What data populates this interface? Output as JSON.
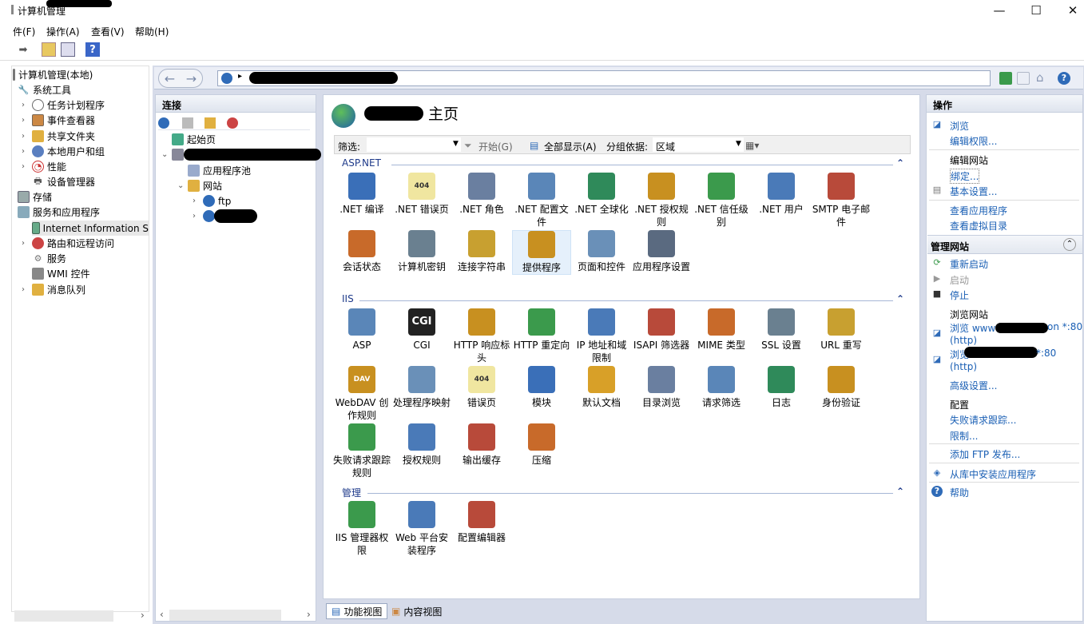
{
  "window": {
    "title": "计算机管理",
    "min": "—",
    "max": "☐",
    "close": "✕"
  },
  "menu": [
    "件(F)",
    "操作(A)",
    "查看(V)",
    "帮助(H)"
  ],
  "left_tree": {
    "root": "计算机管理(本地)",
    "system_tools": "系统工具",
    "task_scheduler": "任务计划程序",
    "event_viewer": "事件查看器",
    "shared_folders": "共享文件夹",
    "local_users": "本地用户和组",
    "performance": "性能",
    "device_manager": "设备管理器",
    "storage": "存储",
    "services_apps": "服务和应用程序",
    "iis": "Internet Information S",
    "routing": "路由和远程访问",
    "services": "服务",
    "wmi": "WMI 控件",
    "msmq": "消息队列"
  },
  "address": {
    "segment": "网站",
    "arrow": "▸"
  },
  "connections": {
    "header": "连接",
    "start_page": "起始页",
    "app_pools": "应用程序池",
    "sites": "网站",
    "ftp": "ftp"
  },
  "center": {
    "title": "主页",
    "filter_label": "筛选:",
    "start_btn": "开始(G)",
    "show_all_btn": "全部显示(A)",
    "group_label": "分组依据:",
    "group_value": "区域",
    "sections": {
      "aspnet": "ASP.NET",
      "iis": "IIS",
      "manage": "管理"
    },
    "collapse": "⌃",
    "aspnet": [
      ".NET 编译",
      ".NET 错误页",
      ".NET 角色",
      ".NET 配置文件",
      ".NET 全球化",
      ".NET 授权规则",
      ".NET 信任级别",
      ".NET 用户",
      "SMTP 电子邮件",
      "会话状态",
      "计算机密钥",
      "连接字符串",
      "提供程序",
      "页面和控件",
      "应用程序设置"
    ],
    "iis_items": [
      "ASP",
      "CGI",
      "HTTP 响应标头",
      "HTTP 重定向",
      "IP 地址和域限制",
      "ISAPI 筛选器",
      "MIME 类型",
      "SSL 设置",
      "URL 重写",
      "WebDAV 创作规则",
      "处理程序映射",
      "错误页",
      "模块",
      "默认文档",
      "目录浏览",
      "请求筛选",
      "日志",
      "身份验证",
      "失败请求跟踪规则",
      "授权规则",
      "输出缓存",
      "压缩"
    ],
    "manage_items": [
      "IIS 管理器权限",
      "Web 平台安装程序",
      "配置编辑器"
    ],
    "icon_labels": {
      "err404": "404",
      "cgi": "CGI",
      "dav": "DAV"
    }
  },
  "view_tabs": {
    "features": "功能视图",
    "content": "内容视图"
  },
  "actions": {
    "header": "操作",
    "browse": "浏览",
    "edit_perms": "编辑权限...",
    "edit_site": "编辑网站",
    "bindings": "绑定...",
    "basic_settings": "基本设置...",
    "view_apps": "查看应用程序",
    "view_vdirs": "查看虚拟目录",
    "manage_site": "管理网站",
    "restart": "重新启动",
    "start": "启动",
    "stop": "停止",
    "browse_site": "浏览网站",
    "browse1_a": "浏览 www",
    "browse1_b": "on *:80",
    "browse1_c": "(http)",
    "browse2_a": "浏览",
    "browse2_b": "*:80",
    "browse2_c": "(http)",
    "advanced": "高级设置...",
    "config": "配置",
    "failed_req": "失败请求跟踪...",
    "limits": "限制...",
    "add_ftp": "添加 FTP 发布...",
    "install_gallery": "从库中安装应用程序",
    "help": "帮助"
  }
}
